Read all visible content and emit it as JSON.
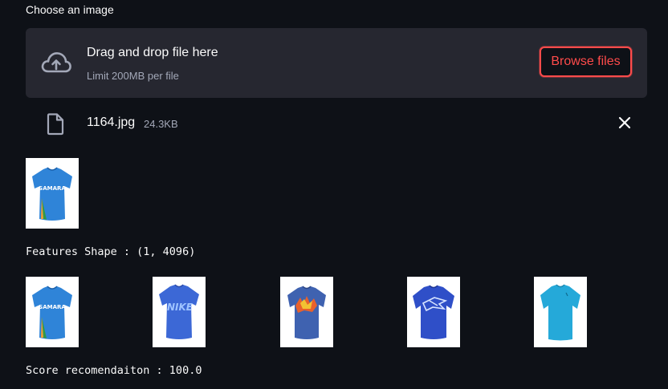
{
  "uploader": {
    "label": "Choose an image",
    "drop_title": "Drag and drop file here",
    "drop_limit": "Limit 200MB per file",
    "browse_label": "Browse files",
    "accent_color": "#ff4b4b"
  },
  "uploaded_file": {
    "name": "1164.jpg",
    "size": "24.3KB",
    "icon": "file-icon",
    "remove_icon": "close-icon"
  },
  "query_image": {
    "jersey_color": "#2f84d8",
    "text": "SAMARA"
  },
  "features_line": "Features Shape : (1, 4096)",
  "recommendations": [
    {
      "jersey_color": "#2f84d8",
      "text": "SAMARA"
    },
    {
      "jersey_color": "#3c68d6",
      "text": "NIKE"
    },
    {
      "jersey_color": "#3f62b0",
      "text": ""
    },
    {
      "jersey_color": "#2f4fc8",
      "text": ""
    },
    {
      "jersey_color": "#25a9d9",
      "text": ""
    }
  ],
  "score_line": "Score recomendaiton : 100.0",
  "theme": {
    "background": "#0e1117",
    "panel": "#262730",
    "muted_text": "#a3a8b8"
  }
}
